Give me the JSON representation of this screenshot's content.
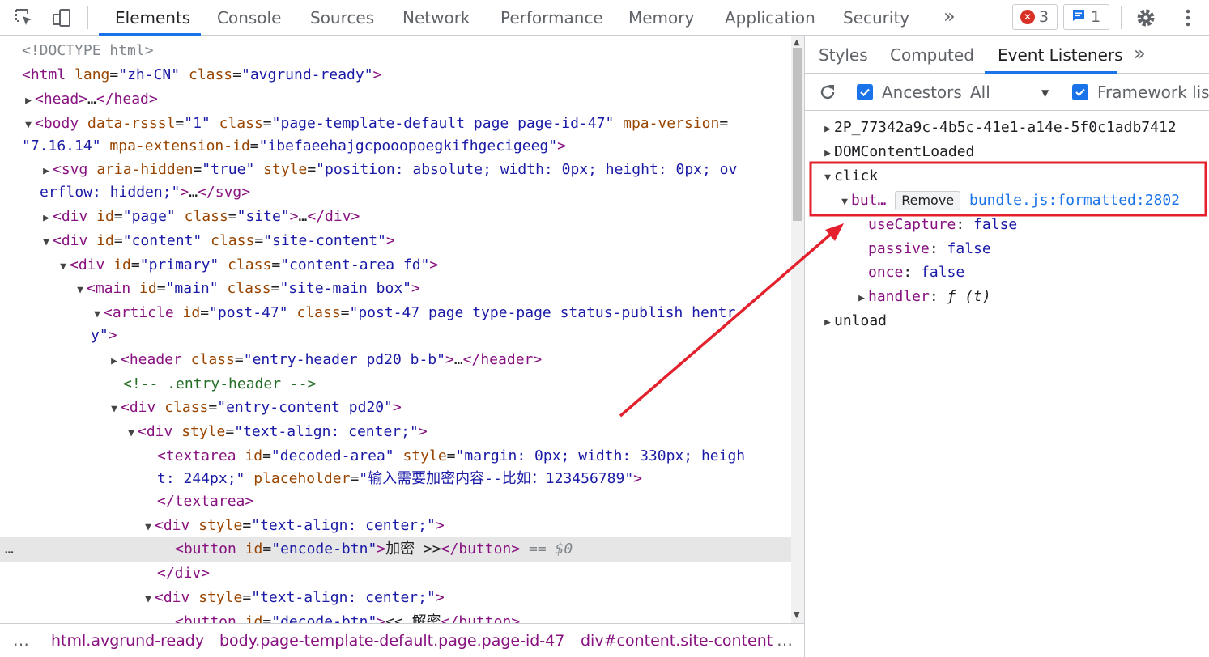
{
  "toolbar": {
    "tabs": [
      "Elements",
      "Console",
      "Sources",
      "Network",
      "Performance",
      "Memory",
      "Application",
      "Security"
    ],
    "more": "»",
    "errors_count": "3",
    "messages_count": "1"
  },
  "dom": {
    "doctype": "<!DOCTYPE html>",
    "l1": {
      "tag": "html",
      "a1": "lang",
      "v1": "\"zh-CN\"",
      "a2": "class",
      "v2": "\"avgrund-ready\""
    },
    "l2": {
      "open": "<head>",
      "dots": "…",
      "close": "</head>"
    },
    "l3": {
      "a1": "data-rsssl",
      "v1": "\"1\"",
      "a2": "class",
      "v2": "\"page-template-default page page-id-47\"",
      "a3": "mpa-version",
      "v3a": "=",
      "v3b": "\"7.16.14\"",
      "a4": "mpa-extension-id",
      "v4": "\"ibefaeehajgcpooopoegkifhgecigeeg\""
    },
    "l4": {
      "a1": "aria-hidden",
      "v1": "\"true\"",
      "a2": "style",
      "v2a": "\"position: absolute; width: 0px; height: 0px; ov",
      "v2b": "erflow: hidden;\"",
      "close": "</svg>"
    },
    "l5": {
      "a1": "id",
      "v1": "\"page\"",
      "a2": "class",
      "v2": "\"site\""
    },
    "l6": {
      "a1": "id",
      "v1": "\"content\"",
      "a2": "class",
      "v2": "\"site-content\""
    },
    "l7": {
      "a1": "id",
      "v1": "\"primary\"",
      "a2": "class",
      "v2": "\"content-area fd\""
    },
    "l8": {
      "a1": "id",
      "v1": "\"main\"",
      "a2": "class",
      "v2": "\"site-main box\""
    },
    "l9": {
      "a1": "id",
      "v1": "\"post-47\"",
      "a2": "class",
      "v2a": "\"post-47 page type-page status-publish hentr",
      "v2b": "y\""
    },
    "l10": {
      "a1": "class",
      "v1": "\"entry-header pd20 b-b\"",
      "close": "</header>"
    },
    "comment": "<!-- .entry-header -->",
    "l11": {
      "a1": "class",
      "v1": "\"entry-content pd20\""
    },
    "l12": {
      "a1": "style",
      "v1": "\"text-align: center;\""
    },
    "l13": {
      "a1": "id",
      "v1": "\"decoded-area\"",
      "a2": "style",
      "v2a": "\"margin: 0px; width: 330px; heigh",
      "v2b": "t: 244px;\"",
      "a3": "placeholder",
      "v3": "\"输入需要加密内容--比如：123456789\""
    },
    "l13close": "</textarea>",
    "l14": {
      "a1": "style",
      "v1": "\"text-align: center;\""
    },
    "l15": {
      "a1": "id",
      "v1": "\"encode-btn\"",
      "text": "加密 >>",
      "close": "</button>",
      "eq": "== $0"
    },
    "l16": "</div>",
    "l17": {
      "a1": "style",
      "v1": "\"text-align: center;\""
    },
    "l18": {
      "a1": "id",
      "v1": "\"decode-btn\"",
      "text": "<< 解密",
      "close": "</button>"
    },
    "row_dots": "…"
  },
  "breadcrumbs": {
    "left_dots": "…",
    "items": [
      "html.avgrund-ready",
      "body.page-template-default.page.page-id-47",
      "div#content.site-content"
    ],
    "right_dots": "…"
  },
  "sidebar": {
    "tabs": [
      "Styles",
      "Computed",
      "Event Listeners"
    ],
    "more": "»",
    "ancestors_label": "Ancestors",
    "filter_value": "All",
    "framework_label": "Framework listeners",
    "events": {
      "e1": "2P_77342a9c-4b5c-41e1-a14e-5f0c1adb7412",
      "e2": "DOMContentLoaded",
      "e3": "click",
      "listener": {
        "node": "but…",
        "remove": "Remove",
        "source": "bundle.js:formatted:2802"
      },
      "useCapture": {
        "k": "useCapture",
        "v": "false"
      },
      "passive": {
        "k": "passive",
        "v": "false"
      },
      "once": {
        "k": "once",
        "v": "false"
      },
      "handler": {
        "k": "handler",
        "v": "ƒ (t)"
      },
      "e4": "unload"
    }
  },
  "colors": {
    "accent": "#1a73e8",
    "annotation": "#e3202b",
    "tag": "#881280",
    "attr": "#994500",
    "value": "#1a1aa6"
  },
  "icons": [
    "inspect-icon",
    "device-toggle-icon",
    "error-icon",
    "message-icon",
    "gear-icon",
    "kebab-icon",
    "refresh-icon"
  ]
}
